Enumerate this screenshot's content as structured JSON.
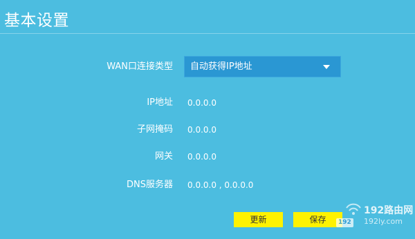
{
  "header": {
    "title": "基本设置"
  },
  "form": {
    "wan_type": {
      "label": "WAN口连接类型",
      "selected": "自动获得IP地址"
    },
    "ip": {
      "label": "IP地址",
      "value": "0.0.0.0"
    },
    "subnet": {
      "label": "子网掩码",
      "value": "0.0.0.0"
    },
    "gateway": {
      "label": "网关",
      "value": "0.0.0.0"
    },
    "dns": {
      "label": "DNS服务器",
      "value": "0.0.0.0 , 0.0.0.0"
    }
  },
  "actions": {
    "refresh_label": "更新",
    "save_label": "保存"
  },
  "watermark": {
    "brand": "192路由网",
    "domain": "192ly.com",
    "badge": "192"
  },
  "colors": {
    "background": "#4cbde0",
    "select_background": "#2a97d3",
    "button_background": "#fff200"
  },
  "icons": {
    "select_caret": "caret-down-icon",
    "watermark_signal": "wifi-signal-icon"
  }
}
